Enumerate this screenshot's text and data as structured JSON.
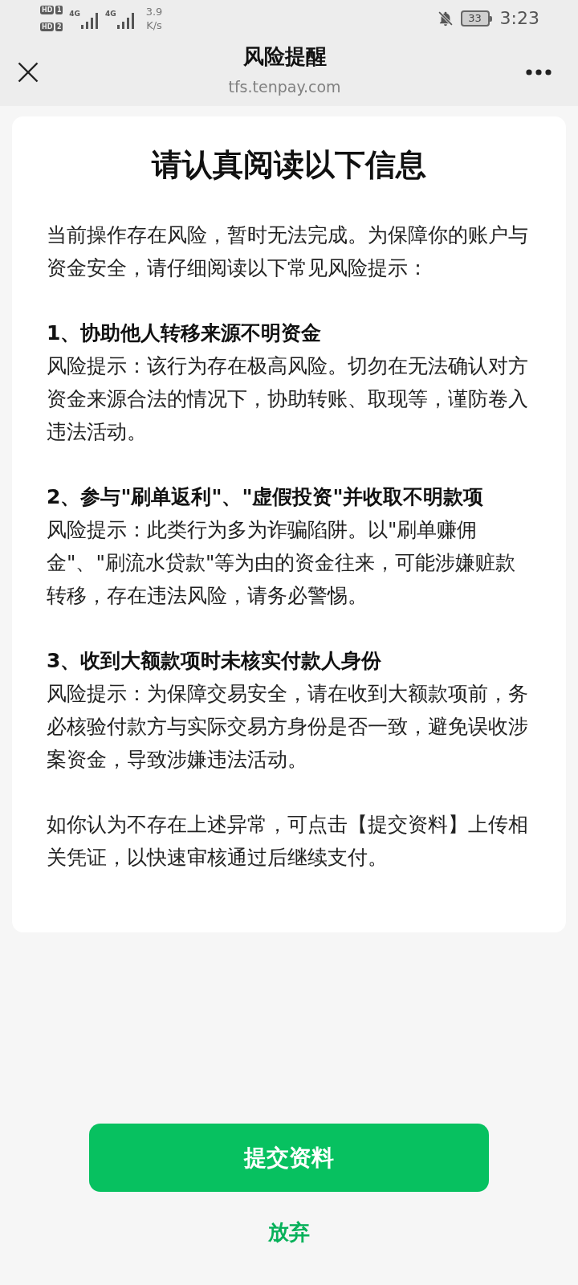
{
  "status_bar": {
    "sims": [
      {
        "label": "HD",
        "slot": "1"
      },
      {
        "label": "HD",
        "slot": "2"
      }
    ],
    "signals": [
      {
        "network": "4G"
      },
      {
        "network": "4G"
      }
    ],
    "speed": {
      "value": "3.9",
      "unit": "K/s"
    },
    "muted": true,
    "battery": "33",
    "time": "3:23"
  },
  "header": {
    "title": "风险提醒",
    "subtitle": "tfs.tenpay.com"
  },
  "notice": {
    "heading": "请认真阅读以下信息",
    "intro": "当前操作存在风险，暂时无法完成。为保障你的账户与资金安全，请仔细阅读以下常见风险提示：",
    "risks": [
      {
        "title": "1、协助他人转移来源不明资金",
        "description": "风险提示：该行为存在极高风险。切勿在无法确认对方资金来源合法的情况下，协助转账、取现等，谨防卷入违法活动。"
      },
      {
        "title": "2、参与\"刷单返利\"、\"虚假投资\"并收取不明款项",
        "description": "风险提示：此类行为多为诈骗陷阱。以\"刷单赚佣金\"、\"刷流水贷款\"等为由的资金往来，可能涉嫌赃款转移，存在违法风险，请务必警惕。"
      },
      {
        "title": "3、收到大额款项时未核实付款人身份",
        "description": "风险提示：为保障交易安全，请在收到大额款项前，务必核验付款方与实际交易方身份是否一致，避免误收涉案资金，导致涉嫌违法活动。"
      }
    ],
    "closing": "如你认为不存在上述异常，可点击【提交资料】上传相关凭证，以快速审核通过后继续支付。"
  },
  "actions": [
    {
      "kind": "primary",
      "label": "提交资料"
    },
    {
      "kind": "link",
      "label": "放弃"
    }
  ]
}
